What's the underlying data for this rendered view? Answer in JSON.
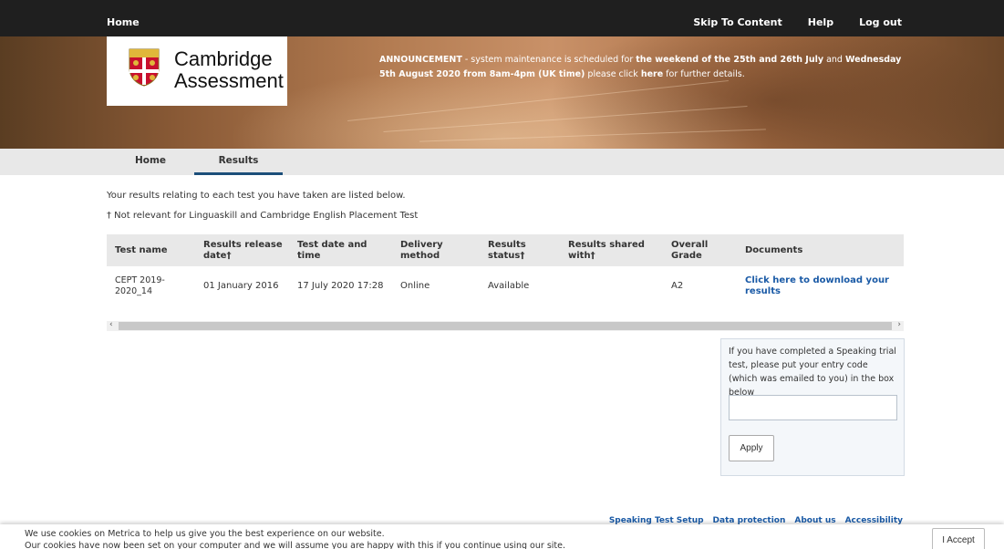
{
  "topbar": {
    "home": "Home",
    "skip": "Skip To Content",
    "help": "Help",
    "logout": "Log out"
  },
  "logo": {
    "line1": "Cambridge",
    "line2": "Assessment"
  },
  "announcement": {
    "label": "ANNOUNCEMENT",
    "text1": " - system maintenance is scheduled for ",
    "bold1": "the weekend of the 25th and 26th July",
    "text2": " and ",
    "bold2": "Wednesday 5th August 2020 from 8am-4pm (UK time)",
    "text3": " please click ",
    "link": "here",
    "text4": " for further details."
  },
  "nav": {
    "home": "Home",
    "results": "Results"
  },
  "main": {
    "intro": "Your results relating to each test you have taken are listed below.",
    "note": "† Not relevant for Linguaskill and Cambridge English Placement Test"
  },
  "table": {
    "headers": {
      "test_name": "Test name",
      "release_date": "Results release date†",
      "test_date": "Test date and time",
      "delivery": "Delivery method",
      "status": "Results status†",
      "shared": "Results shared with†",
      "grade": "Overall Grade",
      "documents": "Documents"
    },
    "rows": [
      {
        "test_name": "CEPT 2019-2020_14",
        "release_date": "01 January 2016",
        "test_date": "17 July 2020 17:28",
        "delivery": "Online",
        "status": "Available",
        "shared": "",
        "grade": "A2",
        "documents": "Click here to download your results"
      }
    ]
  },
  "scrollbar": {
    "left_arrow": "‹",
    "right_arrow": "›"
  },
  "trial": {
    "text": "If you have completed a Speaking trial test, please put your entry code (which was emailed to you) in the box below",
    "input_value": "",
    "apply": "Apply"
  },
  "footer": {
    "links": [
      "Speaking Test Setup",
      "Data protection",
      "About us",
      "Accessibility"
    ]
  },
  "cookie": {
    "line1": "We use cookies on Metrica to help us give you the best experience on our website.",
    "line2": "Our cookies have now been set on your computer and we will assume you are happy with this if you continue using our site.",
    "accept": "I Accept"
  },
  "colors": {
    "topbar": "#1f1f1f",
    "nav_active": "#1c4f7a",
    "link": "#1a5aa6",
    "table_head": "#e8e8e8"
  }
}
